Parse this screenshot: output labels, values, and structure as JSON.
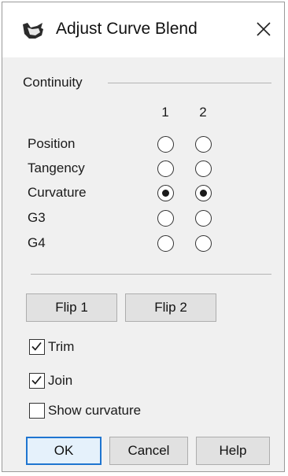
{
  "window": {
    "title": "Adjust Curve Blend",
    "icon": "rhino-icon",
    "close_glyph": "✕"
  },
  "continuity": {
    "group_label": "Continuity",
    "columns": [
      "1",
      "2"
    ],
    "rows": [
      {
        "label": "Position",
        "end1_selected": false,
        "end2_selected": false
      },
      {
        "label": "Tangency",
        "end1_selected": false,
        "end2_selected": false
      },
      {
        "label": "Curvature",
        "end1_selected": true,
        "end2_selected": true
      },
      {
        "label": "G3",
        "end1_selected": false,
        "end2_selected": false
      },
      {
        "label": "G4",
        "end1_selected": false,
        "end2_selected": false
      }
    ]
  },
  "buttons": {
    "flip1": "Flip 1",
    "flip2": "Flip 2",
    "ok": "OK",
    "cancel": "Cancel",
    "help": "Help"
  },
  "options": {
    "trim": {
      "label": "Trim",
      "checked": true
    },
    "join": {
      "label": "Join",
      "checked": true
    },
    "show_curvature": {
      "label": "Show curvature",
      "checked": false
    }
  },
  "colors": {
    "default_button_border": "#1f75d0",
    "dialog_bg": "#f0f0f0"
  }
}
